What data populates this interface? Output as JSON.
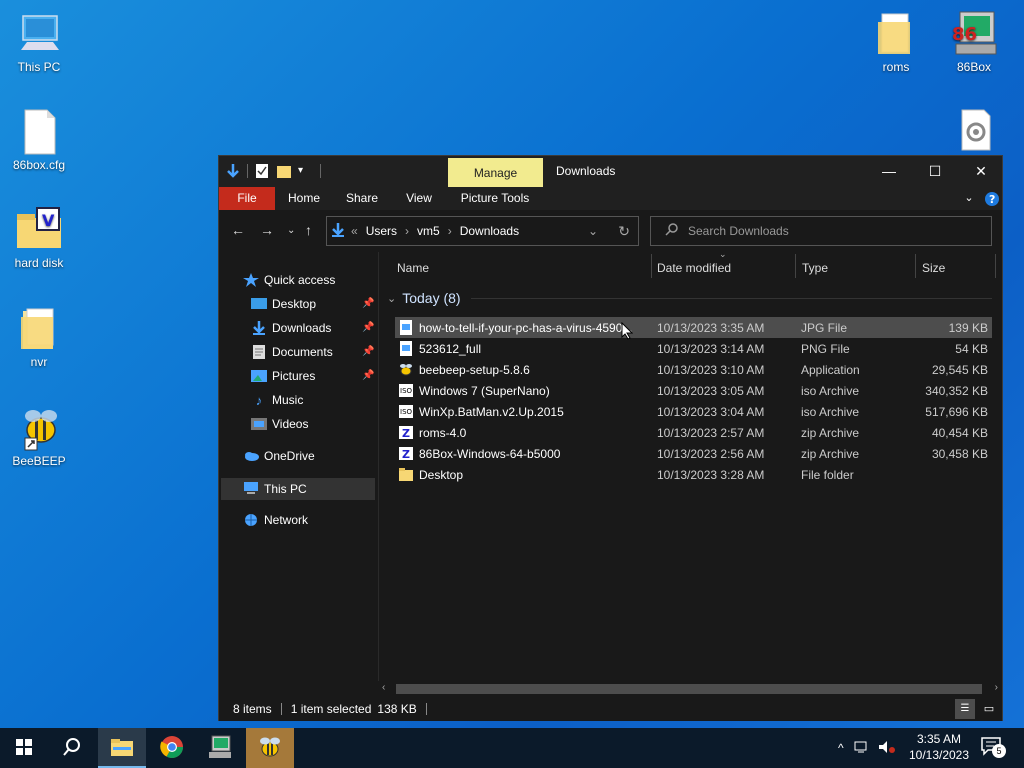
{
  "desktop": {
    "icons_left": [
      {
        "label": "This PC",
        "icon": "this-pc-icon"
      },
      {
        "label": "86box.cfg",
        "icon": "file-icon"
      },
      {
        "label": "hard disk",
        "icon": "folder-icon"
      },
      {
        "label": "nvr",
        "icon": "folder-icon"
      },
      {
        "label": "BeeBEEP",
        "icon": "bee-icon"
      }
    ],
    "icons_right": [
      {
        "label": "roms",
        "icon": "folder-icon"
      },
      {
        "label": "86Box",
        "icon": "86box-icon"
      }
    ]
  },
  "window": {
    "manage_tab": "Manage",
    "title": "Downloads",
    "controls": {
      "minimize": "—",
      "maximize": "☐",
      "close": "✕"
    },
    "ribbon": {
      "tabs": [
        "File",
        "Home",
        "Share",
        "View",
        "Picture Tools"
      ]
    },
    "address": {
      "chevron": "«",
      "parts": [
        "Users",
        "vm5",
        "Downloads"
      ],
      "sep": "›"
    },
    "search": {
      "placeholder": "Search Downloads"
    },
    "nav": {
      "quick_access": "Quick access",
      "items": [
        {
          "label": "Desktop",
          "pinned": true
        },
        {
          "label": "Downloads",
          "pinned": true
        },
        {
          "label": "Documents",
          "pinned": true
        },
        {
          "label": "Pictures",
          "pinned": true
        },
        {
          "label": "Music",
          "pinned": false
        },
        {
          "label": "Videos",
          "pinned": false
        }
      ],
      "onedrive": "OneDrive",
      "this_pc": "This PC",
      "network": "Network"
    },
    "columns": [
      "Name",
      "Date modified",
      "Type",
      "Size"
    ],
    "group_label": "Today (8)",
    "files": [
      {
        "name": "how-to-tell-if-your-pc-has-a-virus-4590...",
        "date": "10/13/2023 3:35 AM",
        "type": "JPG File",
        "size": "139 KB",
        "selected": true
      },
      {
        "name": "523612_full",
        "date": "10/13/2023 3:14 AM",
        "type": "PNG File",
        "size": "54 KB",
        "selected": false
      },
      {
        "name": "beebeep-setup-5.8.6",
        "date": "10/13/2023 3:10 AM",
        "type": "Application",
        "size": "29,545 KB",
        "selected": false
      },
      {
        "name": "Windows 7 (SuperNano)",
        "date": "10/13/2023 3:05 AM",
        "type": "iso Archive",
        "size": "340,352 KB",
        "selected": false
      },
      {
        "name": "WinXp.BatMan.v2.Up.2015",
        "date": "10/13/2023 3:04 AM",
        "type": "iso Archive",
        "size": "517,696 KB",
        "selected": false
      },
      {
        "name": "roms-4.0",
        "date": "10/13/2023 2:57 AM",
        "type": "zip Archive",
        "size": "40,454 KB",
        "selected": false
      },
      {
        "name": "86Box-Windows-64-b5000",
        "date": "10/13/2023 2:56 AM",
        "type": "zip Archive",
        "size": "30,458 KB",
        "selected": false
      },
      {
        "name": "Desktop",
        "date": "10/13/2023 3:28 AM",
        "type": "File folder",
        "size": "",
        "selected": false
      }
    ],
    "status": {
      "items": "8 items",
      "selected": "1 item selected",
      "size": "138 KB"
    }
  },
  "taskbar": {
    "clock_time": "3:35 AM",
    "clock_date": "10/13/2023",
    "notification_count": "5"
  },
  "colors": {
    "accent": "#c42b1c",
    "manage": "#f2eb8f",
    "folder": "#f7d774"
  }
}
